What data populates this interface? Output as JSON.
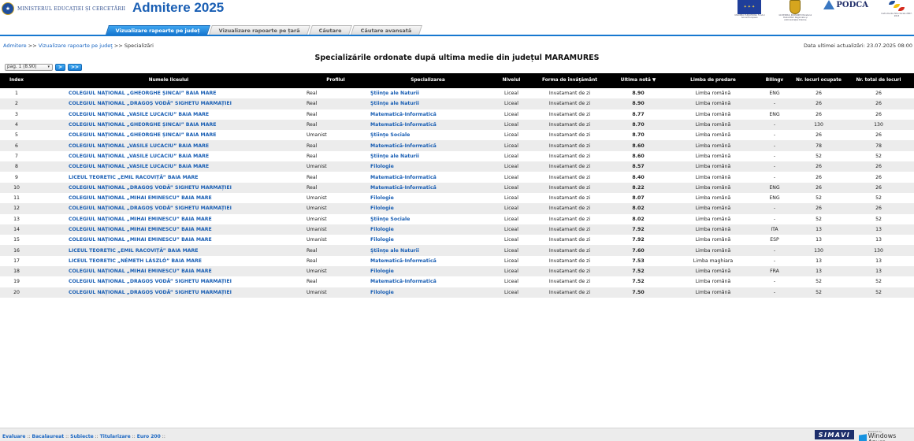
{
  "header": {
    "ministry_name": "MINISTERUL EDUCAȚIEI ȘI CERCETĂRII",
    "app_title": "Admitere 2025",
    "partners": {
      "eu_caption": "UNIUNEA EUROPEANĂ Fondul Social European",
      "gov_caption": "GUVERNUL ROMÂNIEI Ministerul Dezvoltării Regionale și Administrației Publice",
      "podca_label": "PODCA",
      "ro_caption": "Instrumente Structurale 2007-2013"
    }
  },
  "tabs": [
    {
      "label": "Vizualizare rapoarte pe județ",
      "active": true
    },
    {
      "label": "Vizualizare rapoarte pe țară",
      "active": false
    },
    {
      "label": "Căutare",
      "active": false
    },
    {
      "label": "Căutare avansată",
      "active": false
    }
  ],
  "breadcrumb": {
    "item1": "Admitere",
    "sep1": ">>",
    "item2": "Vizualizare rapoarte pe judeţ",
    "sep2": ">>",
    "item3": "Specializări"
  },
  "last_update": "Data ultimei actualizări: 23.07.2025 08:00",
  "page_title": "Specializările ordonate după ultima medie din județul MARAMURES",
  "pager": {
    "select_value": "pag. 1 (8.90)",
    "next_label": ">",
    "last_label": ">>"
  },
  "table": {
    "headers": {
      "index": "Index",
      "school": "Numele liceului",
      "profile": "Profilul",
      "specialization": "Specializarea",
      "level": "Nivelul",
      "form": "Forma de învăţământ",
      "last_grade": "Ultima notă ▼",
      "language": "Limba de predare",
      "bilingual": "Bilingv",
      "occupied": "Nr. locuri ocupate",
      "total": "Nr. total de locuri"
    },
    "rows": [
      {
        "index": "1",
        "school": "COLEGIUL NAȚIONAL „GHEORGHE ȘINCAI” BAIA MARE",
        "profile": "Real",
        "spec": "Ştiinţe ale Naturii",
        "level": "Liceal",
        "form": "Invatamant de zi",
        "grade": "8.90",
        "lang": "Limba română",
        "bilingv": "ENG",
        "occupied": "26",
        "total": "26"
      },
      {
        "index": "2",
        "school": "COLEGIUL NAȚIONAL „DRAGOȘ VODĂ” SIGHETU MARMAȚIEI",
        "profile": "Real",
        "spec": "Ştiinţe ale Naturii",
        "level": "Liceal",
        "form": "Invatamant de zi",
        "grade": "8.90",
        "lang": "Limba română",
        "bilingv": "-",
        "occupied": "26",
        "total": "26"
      },
      {
        "index": "3",
        "school": "COLEGIUL NAȚIONAL „VASILE LUCACIU” BAIA MARE",
        "profile": "Real",
        "spec": "Matematică-Informatică",
        "level": "Liceal",
        "form": "Invatamant de zi",
        "grade": "8.77",
        "lang": "Limba română",
        "bilingv": "ENG",
        "occupied": "26",
        "total": "26"
      },
      {
        "index": "4",
        "school": "COLEGIUL NAȚIONAL „GHEORGHE ȘINCAI” BAIA MARE",
        "profile": "Real",
        "spec": "Matematică-Informatică",
        "level": "Liceal",
        "form": "Invatamant de zi",
        "grade": "8.70",
        "lang": "Limba română",
        "bilingv": "-",
        "occupied": "130",
        "total": "130"
      },
      {
        "index": "5",
        "school": "COLEGIUL NAȚIONAL „GHEORGHE ȘINCAI” BAIA MARE",
        "profile": "Umanist",
        "spec": "Ştiinţe Sociale",
        "level": "Liceal",
        "form": "Invatamant de zi",
        "grade": "8.70",
        "lang": "Limba română",
        "bilingv": "-",
        "occupied": "26",
        "total": "26"
      },
      {
        "index": "6",
        "school": "COLEGIUL NAȚIONAL „VASILE LUCACIU” BAIA MARE",
        "profile": "Real",
        "spec": "Matematică-Informatică",
        "level": "Liceal",
        "form": "Invatamant de zi",
        "grade": "8.60",
        "lang": "Limba română",
        "bilingv": "-",
        "occupied": "78",
        "total": "78"
      },
      {
        "index": "7",
        "school": "COLEGIUL NAȚIONAL „VASILE LUCACIU” BAIA MARE",
        "profile": "Real",
        "spec": "Ştiinţe ale Naturii",
        "level": "Liceal",
        "form": "Invatamant de zi",
        "grade": "8.60",
        "lang": "Limba română",
        "bilingv": "-",
        "occupied": "52",
        "total": "52"
      },
      {
        "index": "8",
        "school": "COLEGIUL NAȚIONAL „VASILE LUCACIU” BAIA MARE",
        "profile": "Umanist",
        "spec": "Filologie",
        "level": "Liceal",
        "form": "Invatamant de zi",
        "grade": "8.57",
        "lang": "Limba română",
        "bilingv": "-",
        "occupied": "26",
        "total": "26"
      },
      {
        "index": "9",
        "school": "LICEUL TEORETIC „EMIL RACOVIȚĂ” BAIA MARE",
        "profile": "Real",
        "spec": "Matematică-Informatică",
        "level": "Liceal",
        "form": "Invatamant de zi",
        "grade": "8.40",
        "lang": "Limba română",
        "bilingv": "-",
        "occupied": "26",
        "total": "26"
      },
      {
        "index": "10",
        "school": "COLEGIUL NAȚIONAL „DRAGOȘ VODĂ” SIGHETU MARMAȚIEI",
        "profile": "Real",
        "spec": "Matematică-Informatică",
        "level": "Liceal",
        "form": "Invatamant de zi",
        "grade": "8.22",
        "lang": "Limba română",
        "bilingv": "ENG",
        "occupied": "26",
        "total": "26"
      },
      {
        "index": "11",
        "school": "COLEGIUL NAȚIONAL „MIHAI EMINESCU” BAIA MARE",
        "profile": "Umanist",
        "spec": "Filologie",
        "level": "Liceal",
        "form": "Invatamant de zi",
        "grade": "8.07",
        "lang": "Limba română",
        "bilingv": "ENG",
        "occupied": "52",
        "total": "52"
      },
      {
        "index": "12",
        "school": "COLEGIUL NAȚIONAL „DRAGOȘ VODĂ” SIGHETU MARMAȚIEI",
        "profile": "Umanist",
        "spec": "Filologie",
        "level": "Liceal",
        "form": "Invatamant de zi",
        "grade": "8.02",
        "lang": "Limba română",
        "bilingv": "-",
        "occupied": "26",
        "total": "26"
      },
      {
        "index": "13",
        "school": "COLEGIUL NAȚIONAL „MIHAI EMINESCU” BAIA MARE",
        "profile": "Umanist",
        "spec": "Ştiinţe Sociale",
        "level": "Liceal",
        "form": "Invatamant de zi",
        "grade": "8.02",
        "lang": "Limba română",
        "bilingv": "-",
        "occupied": "52",
        "total": "52"
      },
      {
        "index": "14",
        "school": "COLEGIUL NAȚIONAL „MIHAI EMINESCU” BAIA MARE",
        "profile": "Umanist",
        "spec": "Filologie",
        "level": "Liceal",
        "form": "Invatamant de zi",
        "grade": "7.92",
        "lang": "Limba română",
        "bilingv": "ITA",
        "occupied": "13",
        "total": "13"
      },
      {
        "index": "15",
        "school": "COLEGIUL NAȚIONAL „MIHAI EMINESCU” BAIA MARE",
        "profile": "Umanist",
        "spec": "Filologie",
        "level": "Liceal",
        "form": "Invatamant de zi",
        "grade": "7.92",
        "lang": "Limba română",
        "bilingv": "ESP",
        "occupied": "13",
        "total": "13"
      },
      {
        "index": "16",
        "school": "LICEUL TEORETIC „EMIL RACOVIȚĂ” BAIA MARE",
        "profile": "Real",
        "spec": "Ştiinţe ale Naturii",
        "level": "Liceal",
        "form": "Invatamant de zi",
        "grade": "7.60",
        "lang": "Limba română",
        "bilingv": "-",
        "occupied": "130",
        "total": "130"
      },
      {
        "index": "17",
        "school": "LICEUL TEORETIC „NÉMETH LÁSZLÓ” BAIA MARE",
        "profile": "Real",
        "spec": "Matematică-Informatică",
        "level": "Liceal",
        "form": "Invatamant de zi",
        "grade": "7.53",
        "lang": "Limba maghiara",
        "bilingv": "-",
        "occupied": "13",
        "total": "13"
      },
      {
        "index": "18",
        "school": "COLEGIUL NAȚIONAL „MIHAI EMINESCU” BAIA MARE",
        "profile": "Umanist",
        "spec": "Filologie",
        "level": "Liceal",
        "form": "Invatamant de zi",
        "grade": "7.52",
        "lang": "Limba română",
        "bilingv": "FRA",
        "occupied": "13",
        "total": "13"
      },
      {
        "index": "19",
        "school": "COLEGIUL NAȚIONAL „DRAGOȘ VODĂ” SIGHETU MARMAȚIEI",
        "profile": "Real",
        "spec": "Matematică-Informatică",
        "level": "Liceal",
        "form": "Invatamant de zi",
        "grade": "7.52",
        "lang": "Limba română",
        "bilingv": "-",
        "occupied": "52",
        "total": "52"
      },
      {
        "index": "20",
        "school": "COLEGIUL NAȚIONAL „DRAGOȘ VODĂ” SIGHETU MARMAȚIEI",
        "profile": "Umanist",
        "spec": "Filologie",
        "level": "Liceal",
        "form": "Invatamant de zi",
        "grade": "7.50",
        "lang": "Limba română",
        "bilingv": "-",
        "occupied": "52",
        "total": "52"
      }
    ]
  },
  "footer": {
    "links": [
      "Evaluare",
      "Bacalaureat",
      "Subiecte",
      "Titularizare",
      "Euro 200"
    ],
    "separator": "::",
    "simavi_label": "SIMAVI",
    "azure_caption": "Powered by",
    "azure_label": "Windows Azure"
  },
  "icons": {
    "gov_logo": "romanian-government-crest-icon",
    "eu_flag": "eu-flag-icon",
    "sort": "sort-descending-icon",
    "dropdown": "chevron-down-icon"
  },
  "colors": {
    "accent": "#1778d0",
    "link": "#1a5fb4",
    "header_bg": "#000000",
    "row_alt": "#ececec"
  }
}
